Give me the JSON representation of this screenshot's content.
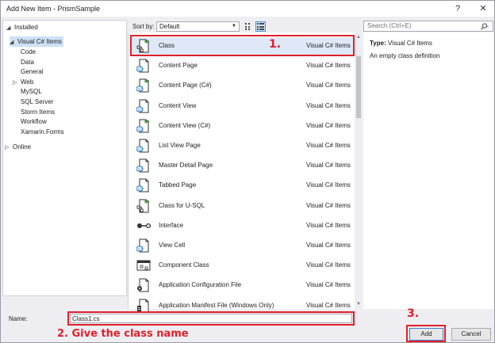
{
  "window": {
    "title": "Add New Item - PrismSample",
    "help_glyph": "?",
    "close_glyph": "✕"
  },
  "tree": {
    "installed": "Installed",
    "selected": "Visual C# Items",
    "children": [
      "Code",
      "Data",
      "General",
      "Web",
      "MySQL",
      "SQL Server",
      "Storm Items",
      "Workflow",
      "Xamarin.Forms"
    ],
    "online": "Online"
  },
  "toolbar": {
    "sort_label": "Sort by:",
    "sort_value": "Default"
  },
  "templates": [
    {
      "name": "Class",
      "category": "Visual C# Items",
      "icon": "class-icon",
      "selected": true
    },
    {
      "name": "Content Page",
      "category": "Visual C# Items",
      "icon": "xaml-page-icon"
    },
    {
      "name": "Content Page (C#)",
      "category": "Visual C# Items",
      "icon": "csharp-page-icon"
    },
    {
      "name": "Content View",
      "category": "Visual C# Items",
      "icon": "xaml-page-icon"
    },
    {
      "name": "Content View (C#)",
      "category": "Visual C# Items",
      "icon": "csharp-page-icon"
    },
    {
      "name": "List View Page",
      "category": "Visual C# Items",
      "icon": "xaml-page-icon"
    },
    {
      "name": "Master Detail Page",
      "category": "Visual C# Items",
      "icon": "xaml-page-icon"
    },
    {
      "name": "Tabbed Page",
      "category": "Visual C# Items",
      "icon": "xaml-page-icon"
    },
    {
      "name": "Class for U-SQL",
      "category": "Visual C# Items",
      "icon": "class-icon"
    },
    {
      "name": "Interface",
      "category": "Visual C# Items",
      "icon": "interface-icon"
    },
    {
      "name": "View Cell",
      "category": "Visual C# Items",
      "icon": "xaml-page-icon"
    },
    {
      "name": "Component Class",
      "category": "Visual C# Items",
      "icon": "component-icon"
    },
    {
      "name": "Application Configuration File",
      "category": "Visual C# Items",
      "icon": "config-file-icon"
    },
    {
      "name": "Application Manifest File (Windows Only)",
      "category": "Visual C# Items",
      "icon": "manifest-file-icon"
    }
  ],
  "search": {
    "placeholder": "Search (Ctrl+E)"
  },
  "details": {
    "type_label": "Type:",
    "type_value": "Visual C# Items",
    "description": "An empty class definition"
  },
  "name_field": {
    "label": "Name:",
    "value": "Class1.cs"
  },
  "buttons": {
    "add": "Add",
    "cancel": "Cancel"
  },
  "annotations": {
    "step1": "1.",
    "step2": "2. Give the class name",
    "step3": "3.",
    "color": "#e0202a"
  }
}
